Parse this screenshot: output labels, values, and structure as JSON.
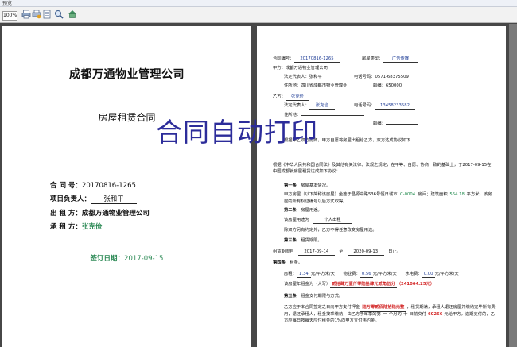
{
  "window": {
    "title": "预览"
  },
  "toolbar": {
    "zoom": "100%",
    "buttons": [
      {
        "icon": "print-icon"
      },
      {
        "icon": "print-setup-icon"
      },
      {
        "icon": "page-setup-icon"
      },
      {
        "icon": "zoom-icon"
      },
      {
        "icon": "home-icon"
      }
    ]
  },
  "page1": {
    "company": "成都万通物业管理公司",
    "doc_title": "房屋租赁合同",
    "contract_no_label": "合    同    号：",
    "contract_no": "20170816-1265",
    "manager_label": "项目负责人：",
    "manager": "张和平",
    "lessor_label": "出    租    方：",
    "lessor": "成都万通物业管理公司",
    "tenant_label": "承    租    方：",
    "tenant": "张克俭",
    "sign_label": "签订日期：",
    "sign_date": "2017-09-15"
  },
  "page2": {
    "contract_no_label": "合同编号：",
    "contract_no": "20170816-1265",
    "house_type_label": "房屋类型：",
    "house_type": "广告传媒",
    "party_a": "甲方：成都万通物业管理公司",
    "legal_rep_label": "法定代表人：",
    "legal_rep": "张和平",
    "phone_label": "电话号码：",
    "phone": "0571-68375509",
    "address_label": "住所地：",
    "address": "四川省成都市物业管理处",
    "postcode_label": "邮编：",
    "postcode": "650000",
    "party_b_label": "乙方：",
    "party_b": "张克俭",
    "b_rep_label": "法定代表人：",
    "b_rep": "张克俭",
    "b_phone_label": "电话号码：",
    "b_phone": "13458233582",
    "b_address_label": "住所地：",
    "b_postcode_label": "邮编：",
    "notice_line": "根据甲乙双方协商，甲方自愿将房屋出租给乙方，双方达成协议如下",
    "intro": "根据《中华人民共和国合同法》及其他有关法律、法规之规定，在平等、自愿、协商一致的基础上，于2017-09-15在中国成都就房屋租赁达成如下协议：",
    "intro_date": "2017-09-15",
    "art1_title": "第一条",
    "art1_name": "房屋基本情况。",
    "art1_text_a": "甲方房屋（以下简称该房屋）坐落于昌源中路536号恒日城市",
    "art1_room": "C-0004",
    "art1_text_b": "房间；建筑面积",
    "art1_area": "564.18",
    "art1_text_c": "平方米，该房屋的所有权证编号以后方式取得。",
    "art2_title": "第二条",
    "art2_name": "房屋用途。",
    "art2_use_label": "该房屋用途为",
    "art2_use": "个人出租",
    "art2_text": "除双方另有约定外，乙方不得任意改变房屋用途。",
    "art3_title": "第三条",
    "art3_name": "租赁期限。",
    "art3_from_label": "租赁期限自",
    "art3_from": "2017-09-14",
    "art3_to_label": "至",
    "art3_to": "2020-09-13",
    "art3_unit": "日止。",
    "art4_title": "第四条",
    "art4_name": "租金。",
    "rent_label": "房租：",
    "rent": "1.34",
    "rent_unit": "元/平方米/天",
    "property_fee_label": "物业费：",
    "property_fee": "0.56",
    "property_unit": "元/平方米/天",
    "water_label": "水电费：",
    "water": "0.00",
    "water_unit": "元/平方米/天",
    "annual_label": "该房屋年租金为（大写）",
    "annual_upper": "贰拾肆万壹仟零陆拾肆元贰角伍分",
    "annual_lower": "（241064.25元）",
    "art5_title": "第五条",
    "art5_name": "租金支付期限与方式。",
    "art5_text_a": "乙方应于本合同签定之日向甲方支付押金",
    "art5_deposit": "陆万零贰佰陆拾陆元整",
    "art5_text_b": "，租赁期满，承租人退还房屋并缴纳完毕所有费用，退还承租人，租金按季缴纳，由乙方于每季的第",
    "art5_month": "一",
    "art5_text_c": "个月的",
    "art5_day": "十",
    "art5_text_d": "日前交付",
    "art5_amount": "60266",
    "art5_text_e": "元给甲方，逾期支付的，乙方应每日按每天应付租金的1%向甲方支付违约金。"
  },
  "overlay": {
    "text": "合同自动打印"
  }
}
